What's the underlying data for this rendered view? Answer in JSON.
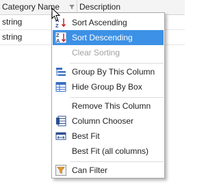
{
  "grid": {
    "columns": [
      "Category Name",
      "Description"
    ],
    "rows": [
      {
        "category": "string",
        "description": ""
      },
      {
        "category": "string",
        "description": ""
      }
    ]
  },
  "menu": {
    "items": [
      {
        "label": "Sort Ascending",
        "icon": "sort-ascending-icon",
        "state": "normal"
      },
      {
        "label": "Sort Descending",
        "icon": "sort-descending-icon",
        "state": "selected"
      },
      {
        "label": "Clear Sorting",
        "icon": "",
        "state": "disabled"
      },
      {
        "label": "Group By This Column",
        "icon": "group-by-column-icon",
        "state": "normal"
      },
      {
        "label": "Hide Group By Box",
        "icon": "group-by-box-icon",
        "state": "normal"
      },
      {
        "label": "Remove This Column",
        "icon": "",
        "state": "normal"
      },
      {
        "label": "Column Chooser",
        "icon": "column-chooser-icon",
        "state": "normal"
      },
      {
        "label": "Best Fit",
        "icon": "best-fit-icon",
        "state": "normal"
      },
      {
        "label": "Best Fit (all columns)",
        "icon": "",
        "state": "normal"
      },
      {
        "label": "Can Filter",
        "icon": "filter-icon",
        "state": "normal"
      }
    ]
  },
  "colors": {
    "highlight": "#3c91e6",
    "disabled_text": "#a0a0a0",
    "border": "#a8a8a8"
  }
}
